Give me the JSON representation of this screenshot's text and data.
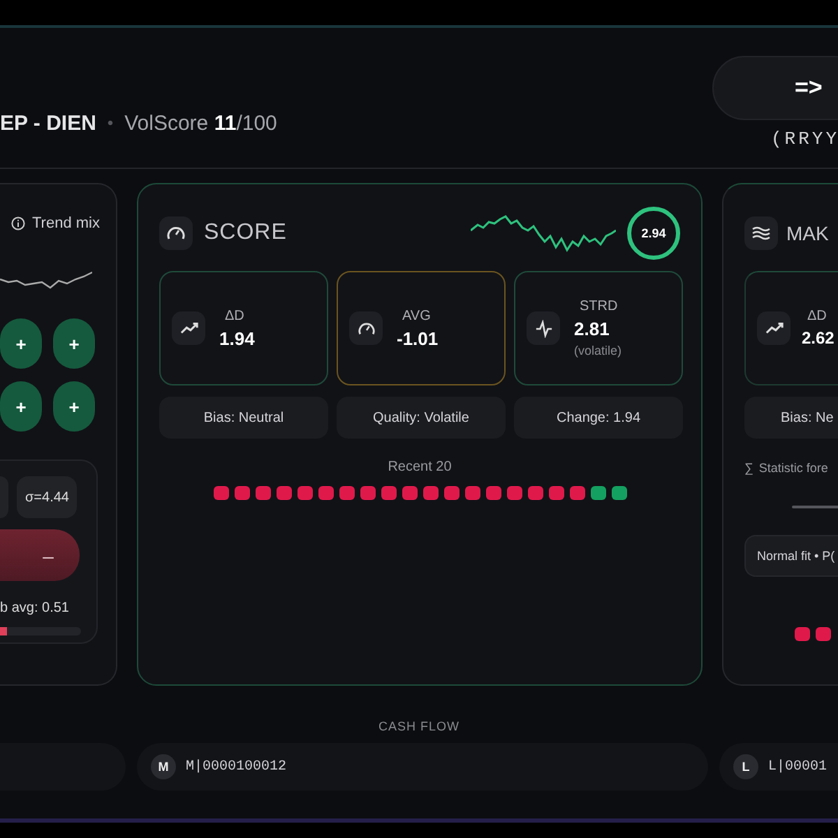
{
  "header": {
    "title": "EP - DIEN",
    "separator": "•",
    "score": "VolScore **11**/100",
    "action_button": "=>",
    "code": "(RRYY"
  },
  "left_panel": {
    "legend": "Trend mix",
    "toggles": [
      {
        "label": "+",
        "on": true
      },
      {
        "label": "+",
        "on": true
      },
      {
        "label": "+",
        "on": true
      },
      {
        "label": "+",
        "on": true
      }
    ],
    "chips": [
      "σ=4.44"
    ],
    "action": "–",
    "avg_label": "b avg: 0.51",
    "progress": {
      "level": 0.08
    }
  },
  "score_card": {
    "title": "SCORE",
    "ring": "2.94",
    "stats": [
      {
        "kind": "trend",
        "label": "ΔD",
        "value": "1.94",
        "color": "#1f4a3a"
      },
      {
        "kind": "gauge",
        "label": "AVG",
        "value": "-1.01",
        "color": "#6b5420"
      },
      {
        "kind": "pulse",
        "label": "STRD",
        "value": "2.81",
        "note": "(volatile)",
        "color": "#1f4a3a"
      }
    ],
    "pills": [
      "Bias: Neutral",
      "Quality: Volatile",
      "Change: 1.94"
    ],
    "recent": {
      "label": "Recent 20",
      "results": [
        {
          "color": "#e0194b"
        },
        {
          "color": "#e0194b"
        },
        {
          "color": "#e0194b"
        },
        {
          "color": "#e0194b"
        },
        {
          "color": "#e0194b"
        },
        {
          "color": "#e0194b"
        },
        {
          "color": "#e0194b"
        },
        {
          "color": "#e0194b"
        },
        {
          "color": "#e0194b"
        },
        {
          "color": "#e0194b"
        },
        {
          "color": "#e0194b"
        },
        {
          "color": "#e0194b"
        },
        {
          "color": "#e0194b"
        },
        {
          "color": "#e0194b"
        },
        {
          "color": "#e0194b"
        },
        {
          "color": "#e0194b"
        },
        {
          "color": "#e0194b"
        },
        {
          "color": "#e0194b"
        },
        {
          "color": "#14a060"
        },
        {
          "color": "#14a060"
        }
      ]
    }
  },
  "right_card": {
    "title": "MAK",
    "stats": [
      {
        "kind": "trend",
        "label": "ΔD",
        "value": "2.62",
        "color": "#1f4a3a"
      }
    ],
    "pills": [
      "Bias: Ne"
    ],
    "sigma": "∑",
    "note": "Statistic fore",
    "fit": "Normal fit • P(",
    "recent": [
      {
        "color": "#e0194b"
      },
      {
        "color": "#e0194b"
      }
    ]
  },
  "cash_flow": {
    "title": "CASH FLOW",
    "entries": [
      {
        "badge": "M",
        "text": "M|0000100012"
      },
      {
        "badge": "L",
        "text": "L|00001"
      }
    ]
  }
}
